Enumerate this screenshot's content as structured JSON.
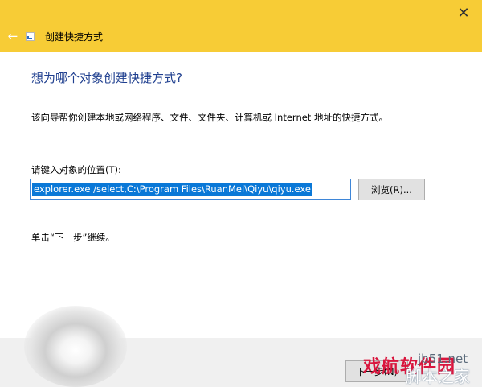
{
  "window": {
    "title": "创建快捷方式",
    "close_glyph": "✕",
    "back_glyph": "←"
  },
  "content": {
    "heading": "想为哪个对象创建快捷方式?",
    "description": "该向导帮你创建本地或网络程序、文件、文件夹、计算机或 Internet 地址的快捷方式。",
    "location_label": "请键入对象的位置(T):",
    "location_value": "explorer.exe /select,C:\\Program Files\\RuanMei\\Qiyu\\qiyu.exe",
    "browse_label": "浏览(R)...",
    "hint": "单击“下一步”继续。"
  },
  "footer": {
    "next_label": "下一步(N)"
  },
  "watermark": {
    "red_text": "戏航软件园",
    "site_text": "jb51.net",
    "white_text": "脚本之家"
  },
  "colors": {
    "titlebar": "#f7cc36",
    "heading": "#1f3f8f",
    "selection": "#0a78d7",
    "input_border": "#3e86d8",
    "button_bg": "#e1e1e1",
    "footer_bg": "#f0f0f0"
  },
  "icons": {
    "back": "back-arrow-icon",
    "app": "shortcut-icon",
    "close": "close-icon"
  }
}
